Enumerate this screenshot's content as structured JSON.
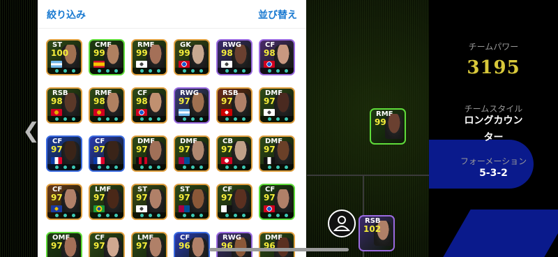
{
  "panel": {
    "filter_label": "絞り込み",
    "sort_label": "並び替え"
  },
  "team": {
    "power_label": "チームパワー",
    "power_value": "3195",
    "style_label": "チームスタイル",
    "style_value_line1": "ロングカウン",
    "style_value_line2": "ター",
    "formation_label": "フォーメーション",
    "formation_value": "5-3-2"
  },
  "cards": [
    {
      "pos": "ST",
      "rating": "100",
      "border": "#e0a040",
      "bg": "#2f4a18",
      "flag": "argentina",
      "face": "#a07050"
    },
    {
      "pos": "CMF",
      "rating": "99",
      "border": "#5fdc3a",
      "bg": "#1e3a12",
      "flag": "spain",
      "face": "#b08060"
    },
    {
      "pos": "RMF",
      "rating": "99",
      "border": "#e0a040",
      "bg": "#2f4a18",
      "flag": "club-white",
      "face": "#a47058"
    },
    {
      "pos": "GK",
      "rating": "99",
      "border": "#e0a040",
      "bg": "#3a4a18",
      "flag": "bayern",
      "face": "#c8a890"
    },
    {
      "pos": "RWG",
      "rating": "98",
      "border": "#9a6ae0",
      "bg": "#3a2a6a",
      "flag": "club-white",
      "face": "#6a4030"
    },
    {
      "pos": "CF",
      "rating": "98",
      "border": "#9a6ae0",
      "bg": "#4a2a6a",
      "flag": "bayern",
      "face": "#c89880"
    },
    {
      "pos": "RSB",
      "rating": "98",
      "border": "#e0a040",
      "bg": "#2f4a18",
      "flag": "man-utd",
      "face": "#5a3828"
    },
    {
      "pos": "RMF",
      "rating": "98",
      "border": "#e0a040",
      "bg": "#2f4a18",
      "flag": "man-utd",
      "face": "#b08060"
    },
    {
      "pos": "CF",
      "rating": "98",
      "border": "#e0a040",
      "bg": "#2f4a18",
      "flag": "bayern",
      "face": "#c09070"
    },
    {
      "pos": "RWG",
      "rating": "97",
      "border": "#9a6ae0",
      "bg": "#3a3a7a",
      "flag": "argentina",
      "face": "#a07050"
    },
    {
      "pos": "RSB",
      "rating": "97",
      "border": "#e0a040",
      "bg": "#6a2a18",
      "flag": "club-red",
      "face": "#b08068"
    },
    {
      "pos": "DMF",
      "rating": "97",
      "border": "#e0a040",
      "bg": "#2f4a18",
      "flag": "club-white",
      "face": "#4a2a20"
    },
    {
      "pos": "CF",
      "rating": "97",
      "border": "#3a6ae0",
      "bg": "#1a3aa0",
      "flag": "france",
      "face": "#3a2418"
    },
    {
      "pos": "CF",
      "rating": "97",
      "border": "#3a6ae0",
      "bg": "#2a3ab0",
      "flag": "france",
      "face": "#3a2418"
    },
    {
      "pos": "DMF",
      "rating": "97",
      "border": "#e0a040",
      "bg": "#2f4a18",
      "flag": "milan",
      "face": "#a07058"
    },
    {
      "pos": "DMF",
      "rating": "97",
      "border": "#e0a040",
      "bg": "#2f4a18",
      "flag": "barcelona",
      "face": "#b08870"
    },
    {
      "pos": "CB",
      "rating": "97",
      "border": "#e0a040",
      "bg": "#2f4a18",
      "flag": "arsenal",
      "face": "#c0a088"
    },
    {
      "pos": "DMF",
      "rating": "97",
      "border": "#e0a040",
      "bg": "#2f4a18",
      "flag": "juventus",
      "face": "#6a4028"
    },
    {
      "pos": "CF",
      "rating": "97",
      "border": "#e0a040",
      "bg": "#6a3a18",
      "flag": "club-blue",
      "face": "#b08068"
    },
    {
      "pos": "LMF",
      "rating": "97",
      "border": "#e0a040",
      "bg": "#2f4a18",
      "flag": "brazil",
      "face": "#4a2818"
    },
    {
      "pos": "ST",
      "rating": "97",
      "border": "#e0a040",
      "bg": "#3a4a18",
      "flag": "club-white",
      "face": "#b08068"
    },
    {
      "pos": "ST",
      "rating": "97",
      "border": "#e0a040",
      "bg": "#2f4a18",
      "flag": "barcelona",
      "face": "#8a5838"
    },
    {
      "pos": "CF",
      "rating": "97",
      "border": "#e0a040",
      "bg": "#2f4a18",
      "flag": "santos",
      "face": "#5a3020"
    },
    {
      "pos": "CF",
      "rating": "97",
      "border": "#5fdc3a",
      "bg": "#1e3a12",
      "flag": "bayern",
      "face": "#b08068"
    },
    {
      "pos": "OMF",
      "rating": "97",
      "border": "#5fdc3a",
      "bg": "#1e3a12",
      "flag": "none",
      "face": "#a47058"
    },
    {
      "pos": "CF",
      "rating": "97",
      "border": "#e0a040",
      "bg": "#2f4a18",
      "flag": "none",
      "face": "#d0a890"
    },
    {
      "pos": "LMF",
      "rating": "97",
      "border": "#e0a040",
      "bg": "#2f4a18",
      "flag": "none",
      "face": "#b08068"
    },
    {
      "pos": "CF",
      "rating": "96",
      "border": "#3a6ae0",
      "bg": "#2a3ab0",
      "flag": "none",
      "face": "#b08068"
    },
    {
      "pos": "RWG",
      "rating": "96",
      "border": "#9a6ae0",
      "bg": "#3a2a6a",
      "flag": "none",
      "face": "#8a5838"
    },
    {
      "pos": "DMF",
      "rating": "96",
      "border": "#e0a040",
      "bg": "#2f4a18",
      "flag": "none",
      "face": "#5a3020"
    }
  ],
  "field_cards": [
    {
      "pos": "RMF",
      "rating": "99",
      "border": "#5fdc3a",
      "bg": "#1e3a12",
      "face": "#6a4030"
    },
    {
      "pos": "RSB",
      "rating": "102",
      "border": "#9a6ae0",
      "bg": "#3a2a6a",
      "face": "#b08068"
    }
  ]
}
